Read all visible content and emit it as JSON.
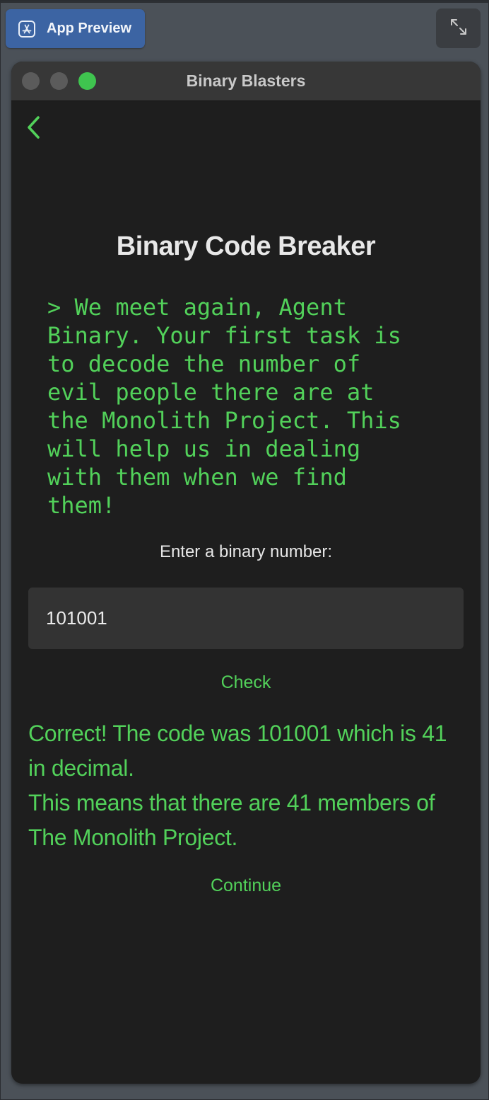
{
  "toolbar": {
    "app_preview_label": "App Preview",
    "app_preview_icon": "app-store-icon",
    "expand_icon": "expand-arrows-icon"
  },
  "window": {
    "title": "Binary Blasters",
    "back_icon": "chevron-left-icon"
  },
  "main": {
    "heading": "Binary Code Breaker",
    "story": "> We meet again, Agent\nBinary. Your first task is\nto decode the number of\nevil people there are at\nthe Monolith Project. This\nwill help us in dealing\nwith them when we find\nthem!",
    "prompt_label": "Enter a binary number:",
    "input_value": "101001",
    "check_label": "Check",
    "result_line1": "Correct! The code was 101001 which is 41 in decimal.",
    "result_line2": "This means that there are 41 members of The Monolith Project.",
    "continue_label": "Continue"
  },
  "colors": {
    "accent_green": "#52d15a",
    "app_preview_blue": "#3c64a3",
    "window_background": "#1e1e1e"
  }
}
